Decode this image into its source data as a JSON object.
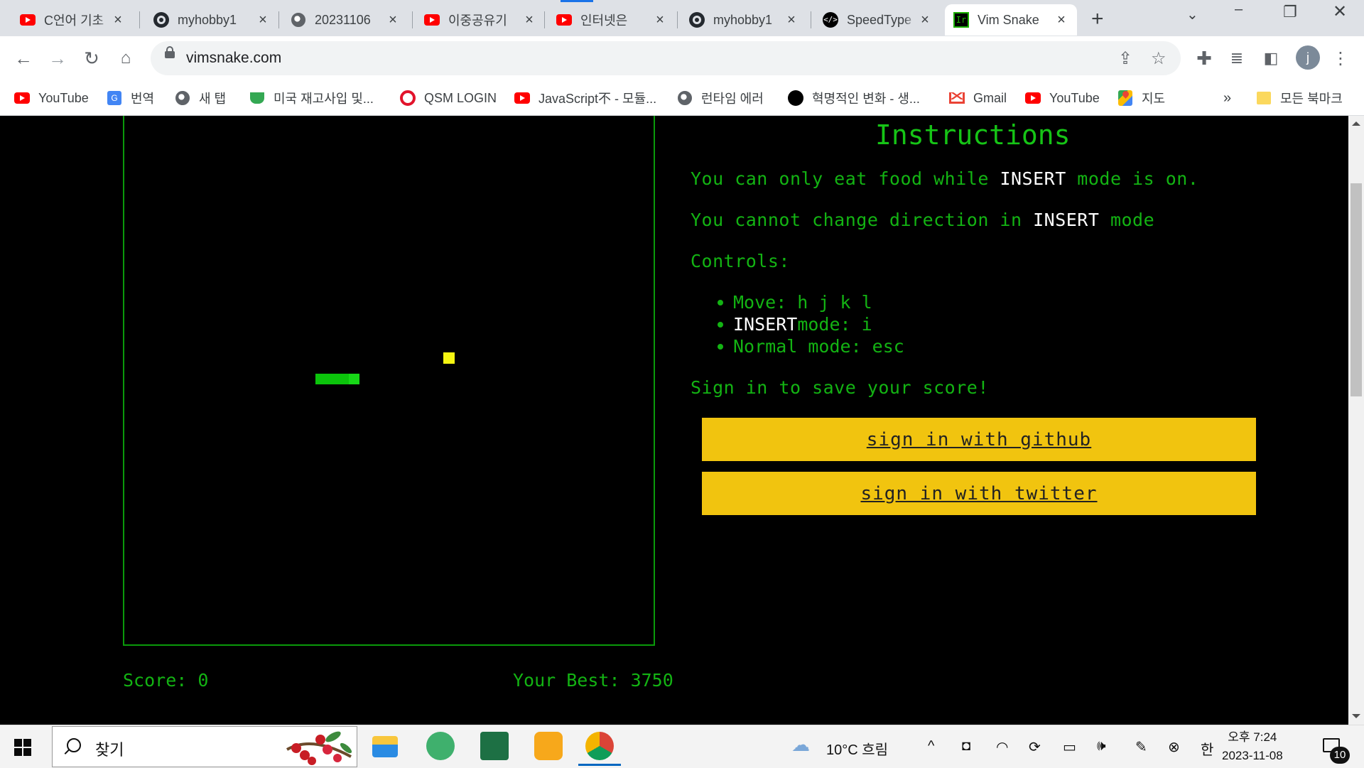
{
  "browser": {
    "tabs": [
      {
        "title": "C언어 기초",
        "icon": "youtube-icon"
      },
      {
        "title": "myhobby1",
        "icon": "github-icon"
      },
      {
        "title": "20231106",
        "icon": "globe-icon"
      },
      {
        "title": "이중공유기",
        "icon": "youtube-icon"
      },
      {
        "title": "인터넷은 ",
        "icon": "youtube-icon"
      },
      {
        "title": "myhobby1",
        "icon": "github-icon"
      },
      {
        "title": "SpeedType",
        "icon": "speedtype-icon"
      },
      {
        "title": "Vim Snake",
        "icon": "vimsnake-icon",
        "active": true
      }
    ],
    "url": "vimsnake.com",
    "profile_initial": "j",
    "bookmarks": [
      {
        "label": "YouTube",
        "icon": "youtube-icon"
      },
      {
        "label": "번역",
        "icon": "translate-icon"
      },
      {
        "label": "새 탭",
        "icon": "globe-icon"
      },
      {
        "label": "미국 재고사입 및...",
        "icon": "cup-icon"
      },
      {
        "label": "QSM LOGIN",
        "icon": "qsm-icon"
      },
      {
        "label": "JavaScript不 - 모듈...",
        "icon": "youtube-icon"
      },
      {
        "label": "런타임 에러",
        "icon": "globe-icon"
      },
      {
        "label": "혁명적인 변화 - 생...",
        "icon": "black-circle-icon"
      },
      {
        "label": "Gmail",
        "icon": "gmail-icon"
      },
      {
        "label": "YouTube",
        "icon": "youtube-icon"
      },
      {
        "label": "지도",
        "icon": "maps-icon"
      }
    ],
    "bookmarks_overflow": "»",
    "all_bookmarks": "모든 북마크"
  },
  "game": {
    "score_label": "Score: 0",
    "best_label": "Your Best: 3750",
    "score": 0,
    "best": 3750
  },
  "instructions": {
    "title": "Instructions",
    "line1_a": "You can only eat food while ",
    "line1_hl": "INSERT",
    "line1_b": " mode is on.",
    "line2_a": "You cannot change direction in ",
    "line2_hl": "INSERT",
    "line2_b": " mode",
    "controls_label": "Controls:",
    "controls": [
      {
        "hl": "",
        "text": "Move: h j k l"
      },
      {
        "hl": "INSERT",
        "text": " mode: i"
      },
      {
        "hl": "",
        "text": "Normal mode: esc"
      }
    ],
    "signin_prompt": "Sign in to save your score!",
    "signin_github": "sign in with github",
    "signin_twitter": "sign in with twitter"
  },
  "colors": {
    "terminal_green": "#13b313",
    "button_yellow": "#f1c40f",
    "food_yellow": "#f5f511"
  },
  "taskbar": {
    "search_placeholder": "찾기",
    "weather": "10°C 흐림",
    "ime": "한",
    "time": "오후 7:24",
    "date": "2023-11-08",
    "notifications": "10"
  }
}
